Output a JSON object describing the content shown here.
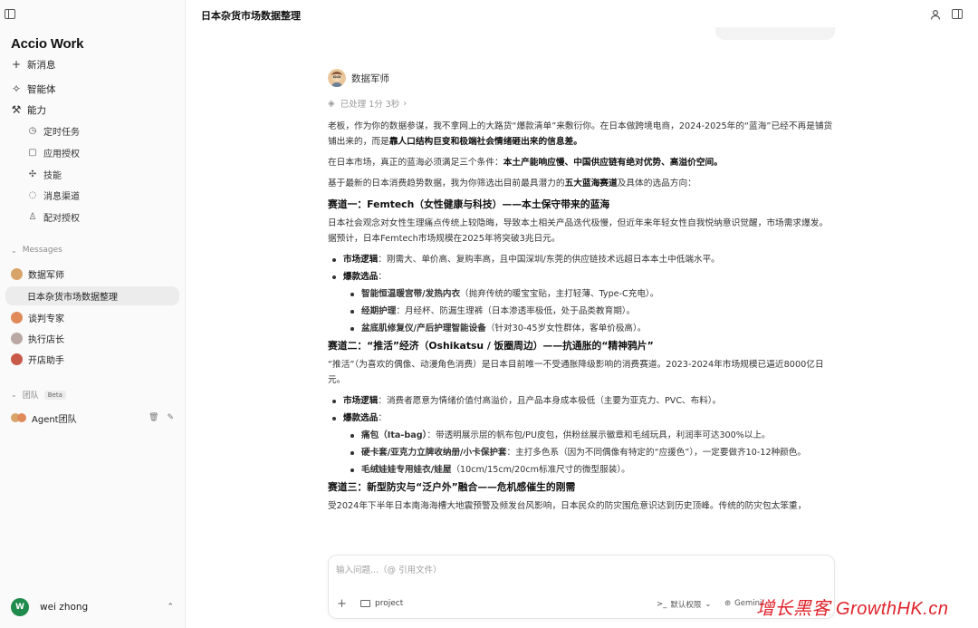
{
  "app": {
    "brand": "Accio Work"
  },
  "sidebar": {
    "nav": [
      {
        "label": "新消息",
        "icon": "plus-icon"
      },
      {
        "label": "智能体",
        "icon": "sparkle-icon"
      },
      {
        "label": "能力",
        "icon": "wrench-icon"
      }
    ],
    "sub": [
      {
        "label": "定时任务",
        "icon": "clock-icon"
      },
      {
        "label": "应用授权",
        "icon": "app-icon"
      },
      {
        "label": "技能",
        "icon": "puzzle-icon"
      },
      {
        "label": "消息渠道",
        "icon": "channel-icon"
      },
      {
        "label": "配对授权",
        "icon": "person-icon"
      }
    ],
    "messages_label": "Messages",
    "messages": [
      {
        "label": "数据军师"
      },
      {
        "label": "日本杂货市场数据整理"
      },
      {
        "label": "谈判专家"
      },
      {
        "label": "执行店长"
      },
      {
        "label": "开店助手"
      }
    ],
    "team_label": "团队",
    "beta": "Beta",
    "team_item": "Agent团队",
    "user": {
      "initial": "W",
      "name": "wei zhong"
    }
  },
  "header": {
    "title": "日本杂货市场数据整理"
  },
  "chat": {
    "agent_name": "数据军师",
    "processed": "已处理 1分 3秒",
    "intro": {
      "a": "老板，作为你的数据参谋，我不拿网上的大路货“爆款清单”来敷衍你。在日本做跨境电商，2024-2025年的“蓝海”已经不再是铺货铺出来的，而是",
      "b": "靠人口结构巨变和极端社会情绪砸出来的信息差。"
    },
    "cond": {
      "a": "在日本市场，真正的蓝海必须满足三个条件：",
      "b": "本土产能响应慢、中国供应链有绝对优势、高溢价空间。"
    },
    "base": {
      "a": "基于最新的日本消费趋势数据，我为你筛选出目前最具潜力的",
      "b": "五大蓝海赛道",
      "c": "及具体的选品方向："
    },
    "t1": {
      "title": "赛道一：Femtech（女性健康与科技）——本土保守带来的蓝海",
      "desc": "日本社会观念对女性生理痛点传统上较隐晦，导致本土相关产品迭代极慢，但近年来年轻女性自我悦纳意识觉醒，市场需求爆发。据预计，日本Femtech市场规模在2025年将突破3兆日元。",
      "logic_label": "市场逻辑",
      "logic": "：刚需大、单价高、复购率高，且中国深圳/东莞的供应链技术远超日本本土中低端水平。",
      "pick_label": "爆款选品",
      "colon": "：",
      "items": [
        {
          "b": "智能恒温暖宫带/发热内衣",
          "t": "（抛弃传统的暖宝宝贴，主打轻薄、Type-C充电）。"
        },
        {
          "b": "经期护理",
          "t": "：月经杯、防漏生理裤（日本渗透率极低，处于品类教育期）。"
        },
        {
          "b": "盆底肌修复仪/产后护理智能设备",
          "t": "（针对30-45岁女性群体，客单价极高）。"
        }
      ]
    },
    "t2": {
      "title": "赛道二：“推活”经济（Oshikatsu / 饭圈周边）——抗通胀的“精神鸦片”",
      "desc": "“推活”（为喜欢的偶像、动漫角色消费）是日本目前唯一不受通胀降级影响的消费赛道。2023-2024年市场规模已逼近8000亿日元。",
      "logic_label": "市场逻辑",
      "logic": "：消费者愿意为情绪价值付高溢价，且产品本身成本极低（主要为亚克力、PVC、布料）。",
      "pick_label": "爆款选品",
      "colon": "：",
      "items": [
        {
          "b": "痛包（Ita-bag）",
          "t": "：带透明展示层的帆布包/PU皮包，供粉丝展示徽章和毛绒玩具，利润率可达300%以上。"
        },
        {
          "b": "硬卡套/亚克力立牌收纳册/小卡保护套",
          "t": "：主打多色系（因为不同偶像有特定的“应援色”），一定要做齐10-12种颜色。"
        },
        {
          "b": "毛绒娃娃专用娃衣/娃屋",
          "t": "（10cm/15cm/20cm标准尺寸的微型服装）。"
        }
      ]
    },
    "t3": {
      "title": "赛道三：新型防灾与“泛户外”融合——危机感催生的刚需",
      "desc": "受2024年下半年日本南海海槽大地震预警及频发台风影响，日本民众的防灾围危意识达到历史顶峰。传统的防灾包太笨重，"
    }
  },
  "input": {
    "placeholder": "输入问题...（@ 引用文件）",
    "project": "project",
    "permission": "默认权限",
    "model": "Gemini"
  },
  "watermark": "增长黑客 GrowthHK.cn"
}
